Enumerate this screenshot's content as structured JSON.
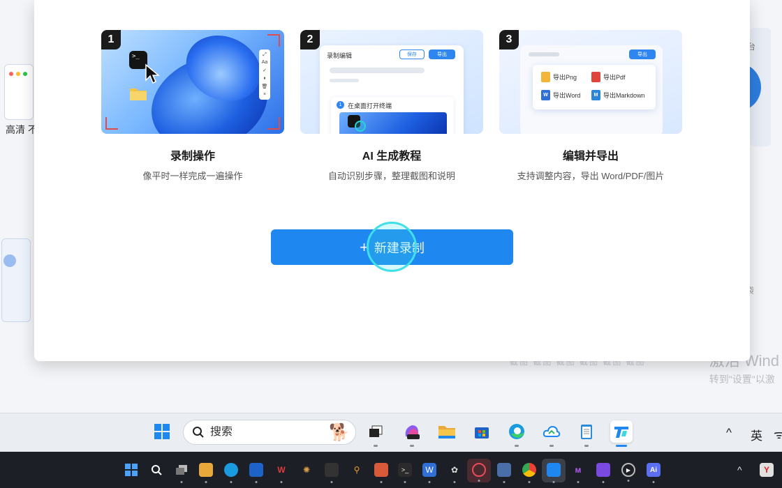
{
  "background_app": {
    "left_label": "高清 不",
    "right_top_text": "台",
    "right_mid_text": "袋",
    "faded_row": "截图 截图 截图 截图 截图 截图"
  },
  "watermark": {
    "line1": "激活 Wind",
    "line2": "转到\"设置\"以激"
  },
  "steps": [
    {
      "number": "1",
      "title": "录制操作",
      "description": "像平时一样完成一遍操作",
      "thumb": {
        "terminal_text": ">_"
      }
    },
    {
      "number": "2",
      "title": "AI 生成教程",
      "description": "自动识别步骤，整理截图和说明",
      "thumb": {
        "panel_title": "录制编辑",
        "save_label": "保存",
        "export_label": "导出",
        "plus": "+",
        "step_number": "1",
        "step_text": "在桌面打开终端"
      }
    },
    {
      "number": "3",
      "title": "编辑并导出",
      "description": "支持调整内容，导出 Word/PDF/图片",
      "thumb": {
        "export_label": "导出",
        "options": [
          "导出Png",
          "导出Pdf",
          "导出Word",
          "导出Markdown"
        ]
      }
    }
  ],
  "primary_button": {
    "icon": "+",
    "label": "新建录制"
  },
  "taskbar": {
    "search_placeholder": "搜索",
    "ime_label": "英",
    "tray_caret": "^",
    "icons": [
      "start-icon",
      "search-icon",
      "task-view-icon",
      "microsoft365-icon",
      "file-explorer-icon",
      "store-icon",
      "edge-icon",
      "cloud-icon",
      "notepad-icon",
      "recorder-app-icon"
    ]
  },
  "dark_taskbar": {
    "tray_caret": "^",
    "icons": [
      "start-icon",
      "search-icon",
      "task-view-icon",
      "folder-icon",
      "edge-icon",
      "store-icon",
      "wps-icon",
      "sun-icon",
      "box-icon",
      "key-icon",
      "doc-icon",
      "terminal-icon",
      "word-icon",
      "chatgpt-icon",
      "screen-recorder-icon",
      "calendar-icon",
      "chrome-icon",
      "recorder-app-icon",
      "m-icon",
      "notes-icon",
      "player-icon",
      "ai-icon",
      "yandex-icon"
    ]
  },
  "colors": {
    "accent": "#1e88f0",
    "click_ring": "#3fe0ea",
    "corner_marks": "#e04c4c"
  }
}
